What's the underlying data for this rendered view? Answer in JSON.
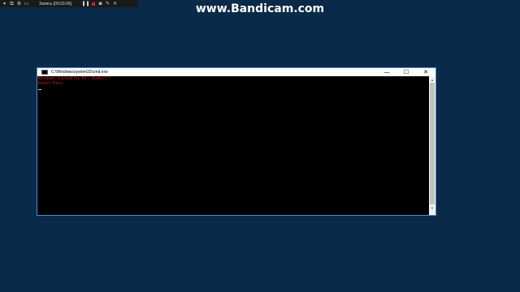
{
  "recorder": {
    "label": "Запись [00:03:06]"
  },
  "watermark": {
    "text": "www.Bandicam.com"
  },
  "cmd": {
    "title": "C:\\Windows\\system32\\cmd.exe",
    "lines": [
      "Windows Locked by Dr. Dudec!!!",
      "Enter Pass:"
    ],
    "text_color": "#e01818",
    "background": "#000000",
    "controls": {
      "minimize": "—",
      "maximize": "☐",
      "close": "✕"
    }
  },
  "desktop": {
    "background": "#0a2a4a"
  }
}
